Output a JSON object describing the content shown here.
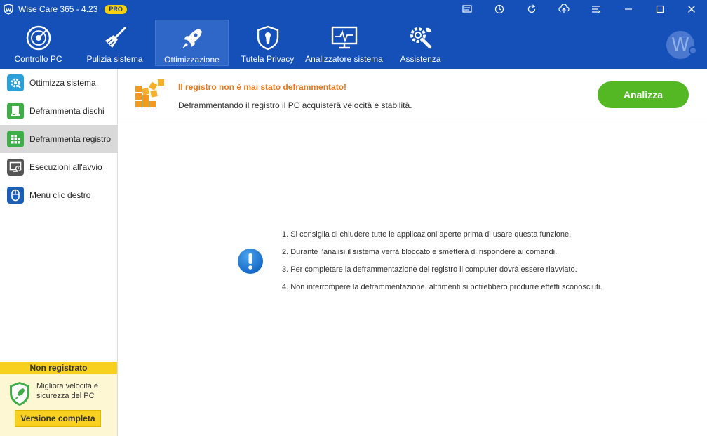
{
  "window": {
    "title": "Wise Care 365 - 4.23",
    "badge": "PRO",
    "brand_color": "#1550b8",
    "controls": [
      "feedback-icon",
      "skin-icon",
      "refresh-icon",
      "upgrade-icon",
      "menu-icon",
      "minimize-icon",
      "maximize-icon",
      "close-icon"
    ]
  },
  "nav": {
    "items": [
      {
        "label": "Controllo PC",
        "icon": "radar-icon"
      },
      {
        "label": "Pulizia sistema",
        "icon": "broom-icon"
      },
      {
        "label": "Ottimizzazione",
        "icon": "rocket-icon",
        "active": true
      },
      {
        "label": "Tutela Privacy",
        "icon": "shield-lock-icon"
      },
      {
        "label": "Analizzatore sistema",
        "icon": "monitor-pulse-icon"
      },
      {
        "label": "Assistenza",
        "icon": "tools-icon"
      }
    ],
    "avatar_letter": "W"
  },
  "sidebar": {
    "items": [
      {
        "label": "Ottimizza sistema",
        "icon": "gear-icon",
        "color": "#2b9fd8"
      },
      {
        "label": "Deframmenta dischi",
        "icon": "disk-icon",
        "color": "#3fae49"
      },
      {
        "label": "Deframmenta registro",
        "icon": "registry-icon",
        "color": "#3fae49",
        "active": true
      },
      {
        "label": "Esecuzioni all'avvio",
        "icon": "startup-icon",
        "color": "#555555"
      },
      {
        "label": "Menu clic destro",
        "icon": "mouse-icon",
        "color": "#1c5fb5"
      }
    ],
    "registration": {
      "header": "Non registrato",
      "text_line1": "Migliora velocità e",
      "text_line2": "sicurezza del PC",
      "button": "Versione completa"
    }
  },
  "banner": {
    "title": "Il registro non è mai stato deframmentato!",
    "subtitle": "Deframmentando il registro il PC acquisterà velocità e stabilità.",
    "button": "Analizza",
    "title_color": "#e8771a",
    "button_color": "#53b824"
  },
  "notes": [
    "1. Si consiglia di chiudere tutte le applicazioni aperte prima di usare questa funzione.",
    "2. Durante l'analisi il sistema verrà bloccato e smetterà di rispondere ai comandi.",
    "3. Per completare la deframmentazione del registro il computer dovrà essere riavviato.",
    "4. Non interrompere la deframmentazione, altrimenti si potrebbero produrre effetti sconosciuti."
  ]
}
